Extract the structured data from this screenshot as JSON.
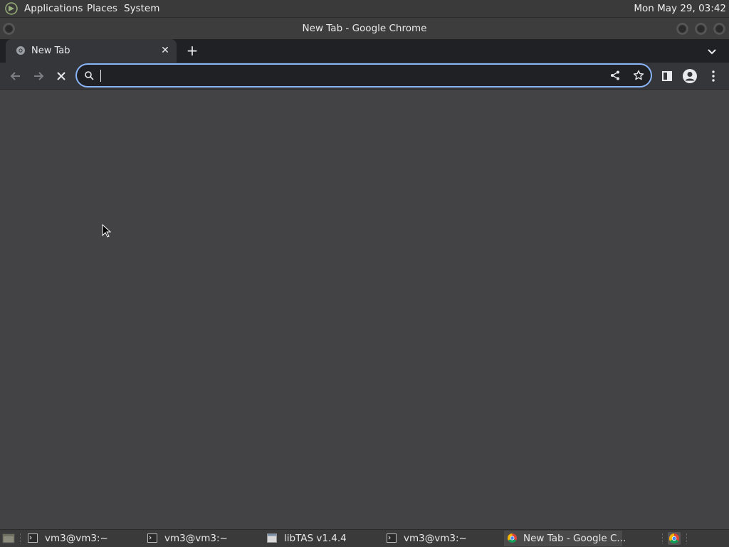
{
  "top_panel": {
    "menus": [
      "Applications",
      "Places",
      "System"
    ],
    "clock": "Mon May 29, 03:42"
  },
  "window": {
    "title": "New Tab - Google Chrome"
  },
  "browser": {
    "tabs": [
      {
        "label": "New Tab",
        "active": true
      }
    ],
    "omnibox": {
      "value": "",
      "placeholder": ""
    }
  },
  "taskbar": {
    "items": [
      {
        "label": "vm3@vm3:~",
        "icon": "terminal-icon"
      },
      {
        "label": "vm3@vm3:~",
        "icon": "terminal-icon"
      },
      {
        "label": "libTAS v1.4.4",
        "icon": "window-icon"
      },
      {
        "label": "vm3@vm3:~",
        "icon": "terminal-icon"
      },
      {
        "label": "New Tab - Google C...",
        "icon": "chrome-icon",
        "active": true
      }
    ]
  },
  "colors": {
    "accent": "#8ab4f8",
    "content_bg": "#434346",
    "tabstrip_bg": "#202124",
    "toolbar_bg": "#35363a"
  }
}
